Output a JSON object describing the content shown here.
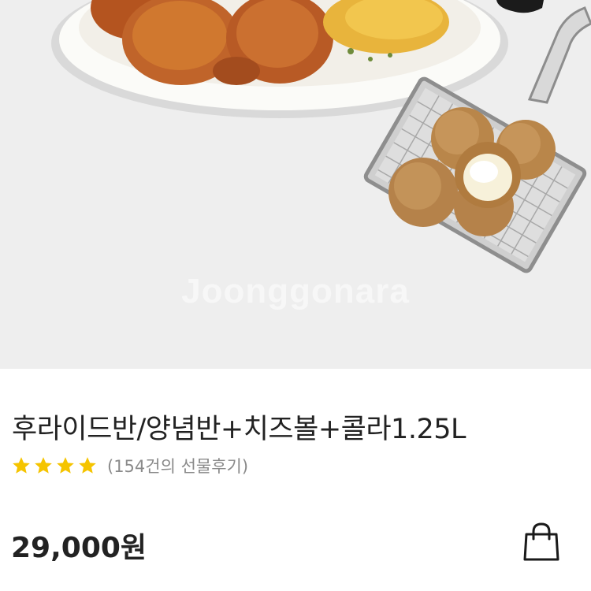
{
  "product": {
    "watermark": "Joonggonara",
    "title": "후라이드반/양념반+치즈볼+콜라1.25L",
    "rating": {
      "stars": 4,
      "reviews_text": "(154건의 선물후기)"
    },
    "price": "29,000원"
  },
  "icons": {
    "rating": "star-icon",
    "cart": "shopping-bag-icon"
  },
  "colors": {
    "star": "#f5c400",
    "hero_bg": "#eeeeee",
    "text": "#222222",
    "subtext": "#8a8a8a"
  }
}
